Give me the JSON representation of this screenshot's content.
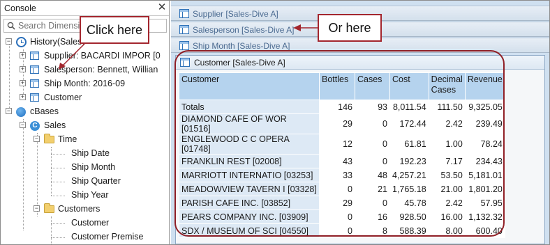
{
  "console": {
    "title": "Console",
    "close_glyph": "✕",
    "search_placeholder": "Search Dimensions",
    "tree": [
      {
        "label": "History(Sales)",
        "icon": "history-icon"
      },
      {
        "label": "Supplier: BACARDI IMPOR [0",
        "icon": "grid-icon"
      },
      {
        "label": "Salesperson: Bennett, Willian",
        "icon": "grid-icon"
      },
      {
        "label": "Ship Month: 2016-09",
        "icon": "grid-icon"
      },
      {
        "label": "Customer",
        "icon": "grid-icon"
      },
      {
        "label": "cBases",
        "icon": "cbase-icon"
      },
      {
        "label": "Sales",
        "icon": "cbase-c-icon"
      },
      {
        "label": "Time",
        "icon": "folder-icon"
      },
      {
        "label": "Ship Date"
      },
      {
        "label": "Ship Month"
      },
      {
        "label": "Ship Quarter"
      },
      {
        "label": "Ship Year"
      },
      {
        "label": "Customers",
        "icon": "folder-icon"
      },
      {
        "label": "Customer"
      },
      {
        "label": "Customer Premise"
      }
    ],
    "expander_plus": "+",
    "expander_minus": "−"
  },
  "tabs": [
    {
      "label": "Supplier [Sales-Dive A]"
    },
    {
      "label": "Salesperson [Sales-Dive A]"
    },
    {
      "label": "Ship Month [Sales-Dive A]"
    }
  ],
  "panel": {
    "title": "Customer [Sales-Dive A]",
    "columns": [
      "Customer",
      "Bottles",
      "Cases",
      "Cost",
      "Decimal Cases",
      "Revenue"
    ],
    "rows": [
      [
        "Totals",
        "146",
        "93",
        "8,011.54",
        "111.50",
        "9,325.05"
      ],
      [
        "DIAMOND CAFE OF WOR [01516]",
        "29",
        "0",
        "172.44",
        "2.42",
        "239.49"
      ],
      [
        "ENGLEWOOD C C OPERA [01748]",
        "12",
        "0",
        "61.81",
        "1.00",
        "78.24"
      ],
      [
        "FRANKLIN REST [02008]",
        "43",
        "0",
        "192.23",
        "7.17",
        "234.43"
      ],
      [
        "MARRIOTT INTERNATIO [03253]",
        "33",
        "48",
        "4,257.21",
        "53.50",
        "5,181.01"
      ],
      [
        "MEADOWVIEW TAVERN I [03328]",
        "0",
        "21",
        "1,765.18",
        "21.00",
        "1,801.20"
      ],
      [
        "PARISH CAFE INC. [03852]",
        "29",
        "0",
        "45.78",
        "2.42",
        "57.95"
      ],
      [
        "PEARS COMPANY INC. [03909]",
        "0",
        "16",
        "928.50",
        "16.00",
        "1,132.32"
      ],
      [
        "SDX / MUSEUM OF SCI [04550]",
        "0",
        "8",
        "588.39",
        "8.00",
        "600.40"
      ]
    ]
  },
  "annotations": {
    "click_here": "Click here",
    "or_here": "Or here",
    "color": "#a3262e"
  }
}
